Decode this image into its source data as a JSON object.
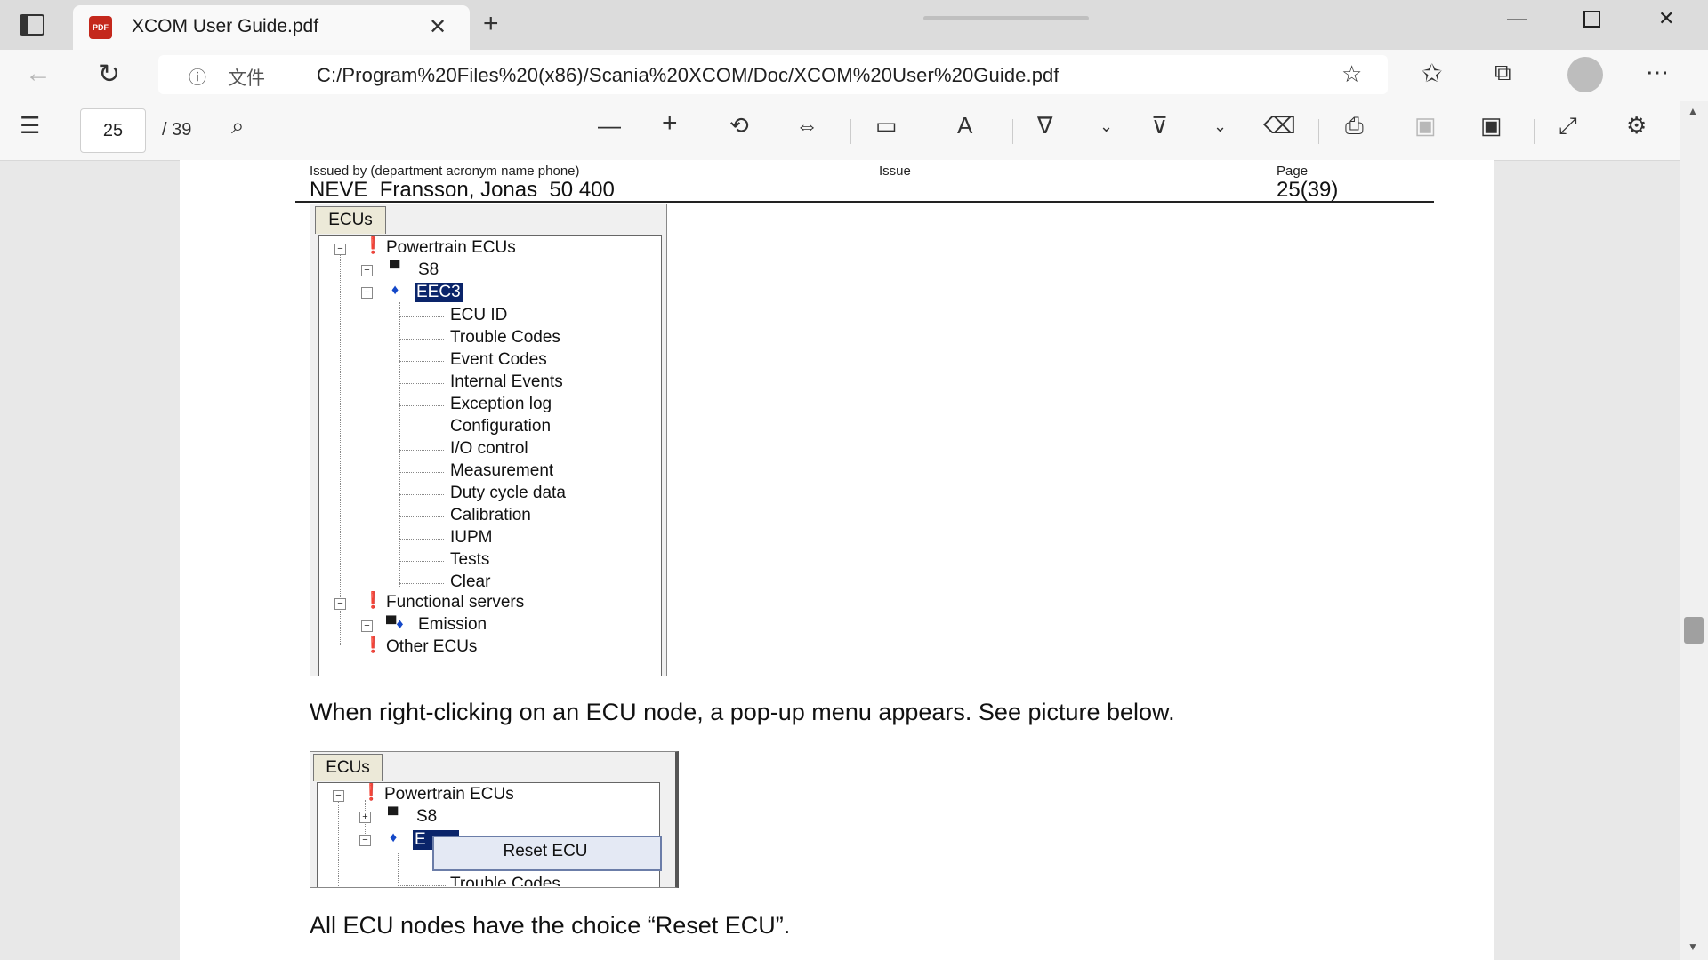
{
  "browser": {
    "tab_title": "XCOM User Guide.pdf",
    "tab_badge": "PDF",
    "address_prefix": "文件",
    "address_url": "C:/Program%20Files%20(x86)/Scania%20XCOM/Doc/XCOM%20User%20Guide.pdf"
  },
  "pdf_toolbar": {
    "page_current": "25",
    "page_total": "/ 39"
  },
  "document": {
    "header": {
      "issued_by_label": "Issued by (department acronym name phone)",
      "issued_by_value": "NEVE  Fransson, Jonas  50 400",
      "issue_label": "Issue",
      "page_label": "Page",
      "page_value": "25(39)"
    },
    "figure1": {
      "tab_label": "ECUs",
      "powertrain": "Powertrain ECUs",
      "s8": "S8",
      "eec3": "EEC3",
      "children": [
        "ECU ID",
        "Trouble Codes",
        "Event Codes",
        "Internal Events",
        "Exception log",
        "Configuration",
        "I/O control",
        "Measurement",
        "Duty cycle data",
        "Calibration",
        "IUPM",
        "Tests",
        "Clear"
      ],
      "functional": "Functional servers",
      "emission": "Emission",
      "other": "Other ECUs"
    },
    "paragraph1": "When right-clicking on an ECU node, a pop-up menu appears. See picture below.",
    "figure2": {
      "tab_label": "ECUs",
      "powertrain": "Powertrain ECUs",
      "s8": "S8",
      "eec3_partial": "E",
      "menu_item": "Reset ECU",
      "partial_child": "Trouble Codes"
    },
    "paragraph2": "All ECU nodes have the choice “Reset ECU”."
  }
}
